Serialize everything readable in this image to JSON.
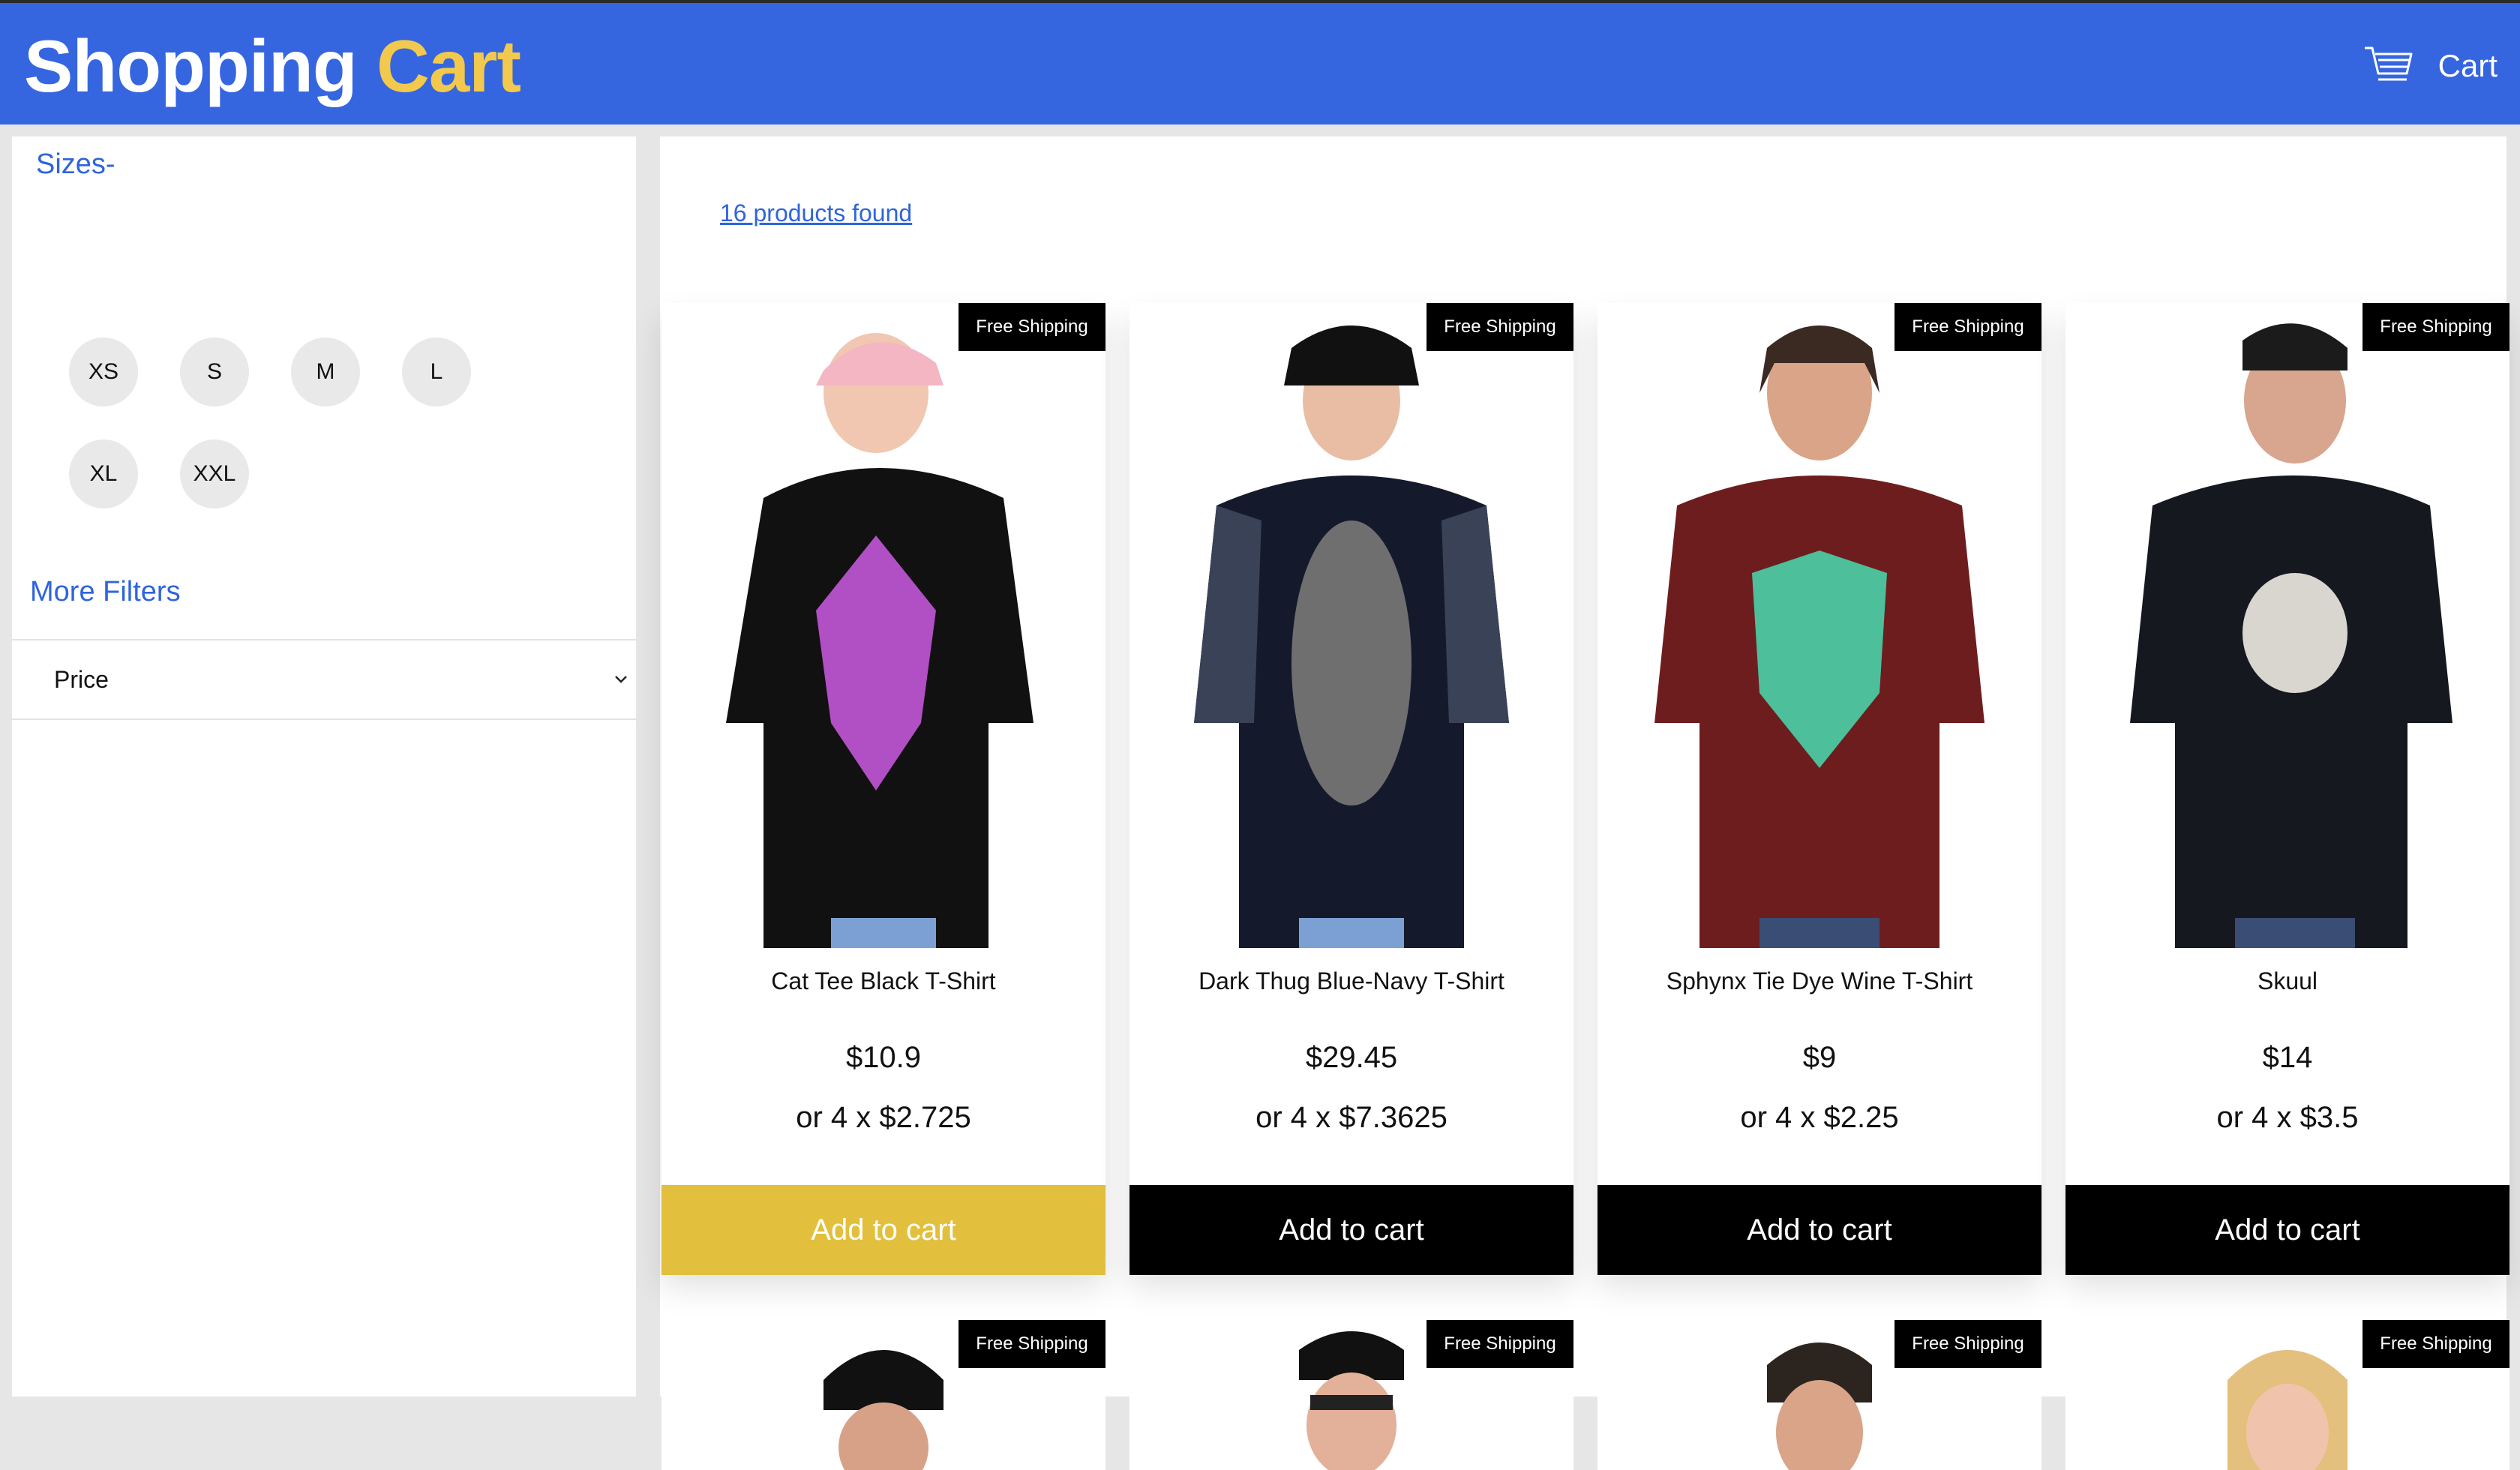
{
  "header": {
    "brand_first": "Shopping",
    "brand_second": "Cart",
    "cart_label": "Cart",
    "bg_color": "#3566e0",
    "accent_color": "#f2c94c"
  },
  "filters": {
    "sizes_title": "Sizes-",
    "sizes": [
      "XS",
      "S",
      "M",
      "L",
      "XL",
      "XXL"
    ],
    "more_filters_title": "More Filters",
    "price_label": "Price"
  },
  "products": {
    "count_text": "16 products found",
    "badge_text": "Free Shipping",
    "add_to_cart_label": "Add to cart",
    "items": [
      {
        "title": "Cat Tee Black T-Shirt",
        "price": "$10.9",
        "installment": "or 4 x $2.725",
        "shirt_color": "#111111",
        "hovered": true
      },
      {
        "title": "Dark Thug Blue-Navy T-Shirt",
        "price": "$29.45",
        "installment": "or 4 x $7.3625",
        "shirt_color": "#141a2b",
        "hovered": false
      },
      {
        "title": "Sphynx Tie Dye Wine T-Shirt",
        "price": "$9",
        "installment": "or 4 x $2.25",
        "shirt_color": "#6e1d1f",
        "hovered": false
      },
      {
        "title": "Skuul",
        "price": "$14",
        "installment": "or 4 x $3.5",
        "shirt_color": "#16181f",
        "hovered": false
      }
    ]
  }
}
